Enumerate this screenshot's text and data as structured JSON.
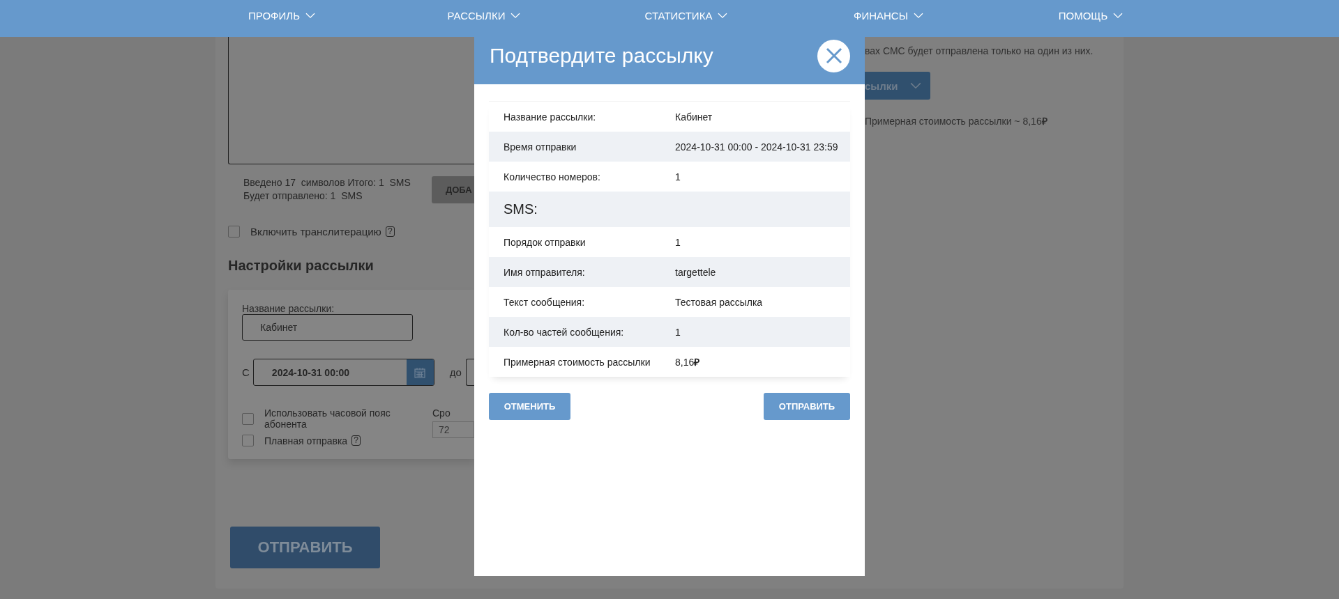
{
  "nav": [
    {
      "label": "ПРОФИЛЬ"
    },
    {
      "label": "РАССЫЛКИ"
    },
    {
      "label": "СТАТИСТИКА"
    },
    {
      "label": "ФИНАНСЫ"
    },
    {
      "label": "ПОМОЩЬ"
    }
  ],
  "background": {
    "message": {
      "counter_lines": [
        "Введено 17  символов Итого: 1  SMS",
        "Будет отправлено: 1  SMS"
      ],
      "add_button": "ДОБА"
    },
    "transliteration": {
      "label": "Включить транслитерацию",
      "checked": false,
      "help": "?"
    },
    "settings": {
      "title": "Настройки рассылки",
      "name_label": "Название рассылки:",
      "name_value": "Кабинет",
      "from_label": "С",
      "from_value": "2024-10-31 00:00",
      "to_label": "до",
      "options": [
        {
          "label": "Использовать часовой пояс абонента",
          "checked": false
        },
        {
          "label": "Плавная отправка",
          "checked": false,
          "help": "?"
        }
      ],
      "term_label": "Сро",
      "term_value": "72"
    },
    "send_button": "ОТПРАВИТЬ",
    "notice": "вах СМС будет отправлена только на один из них.",
    "mailing_button": "сылки",
    "estimate": "Примерная стоимость рассылки ~ 8,16**₽**"
  },
  "dialog": {
    "title": "Подтвердите рассылку",
    "rows": [
      {
        "kind": "field",
        "label": "Название рассылки:",
        "value": "Кабинет"
      },
      {
        "kind": "field",
        "label": "Время отправки",
        "value": "2024-10-31 00:00 - 2024-10-31 23:59"
      },
      {
        "kind": "field",
        "label": "Количество номеров:",
        "value": "1"
      },
      {
        "kind": "section",
        "label": "SMS:"
      },
      {
        "kind": "field",
        "label": "Порядок отправки",
        "value": "1"
      },
      {
        "kind": "field",
        "label": "Имя отправителя:",
        "value": "targettele"
      },
      {
        "kind": "field",
        "label": "Текст сообщения:",
        "value": "Тестовая рассылка"
      },
      {
        "kind": "field",
        "label": "Кол-во частей сообщения:",
        "value": "1"
      },
      {
        "kind": "field",
        "label": "Примерная стоимость рассылки",
        "value": "8,16**₽**"
      }
    ],
    "cancel_button": "ОТМЕНИТЬ",
    "send_button": "ОТПРАВИТЬ"
  }
}
